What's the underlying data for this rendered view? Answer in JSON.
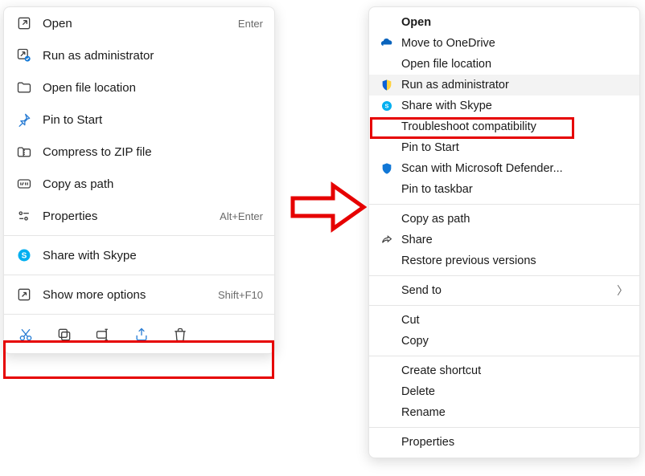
{
  "left_menu": {
    "items": [
      {
        "label": "Open",
        "hotkey": "Enter",
        "icon": "open"
      },
      {
        "label": "Run as administrator",
        "hotkey": "",
        "icon": "admin"
      },
      {
        "label": "Open file location",
        "hotkey": "",
        "icon": "folder"
      },
      {
        "label": "Pin to Start",
        "hotkey": "",
        "icon": "pin"
      },
      {
        "label": "Compress to ZIP file",
        "hotkey": "",
        "icon": "zip"
      },
      {
        "label": "Copy as path",
        "hotkey": "",
        "icon": "path"
      },
      {
        "label": "Properties",
        "hotkey": "Alt+Enter",
        "icon": "props"
      }
    ],
    "skype": {
      "label": "Share with Skype",
      "icon": "skype"
    },
    "more": {
      "label": "Show more options",
      "hotkey": "Shift+F10",
      "icon": "more"
    },
    "toolbar": [
      "cut",
      "copy",
      "rename",
      "share",
      "delete"
    ]
  },
  "right_menu": {
    "g1": [
      {
        "label": "Open",
        "bold": true,
        "icon": ""
      },
      {
        "label": "Move to OneDrive",
        "icon": "onedrive"
      },
      {
        "label": "Open file location",
        "icon": ""
      },
      {
        "label": "Run as administrator",
        "icon": "shield",
        "hover": true
      },
      {
        "label": "Share with Skype",
        "icon": "skype"
      },
      {
        "label": "Troubleshoot compatibility",
        "icon": ""
      },
      {
        "label": "Pin to Start",
        "icon": ""
      },
      {
        "label": "Scan with Microsoft Defender...",
        "icon": "defender"
      },
      {
        "label": "Pin to taskbar",
        "icon": ""
      }
    ],
    "g2": [
      {
        "label": "Copy as path",
        "icon": ""
      },
      {
        "label": "Share",
        "icon": "share"
      },
      {
        "label": "Restore previous versions",
        "icon": ""
      }
    ],
    "g3": [
      {
        "label": "Send to",
        "icon": "",
        "submenu": true
      }
    ],
    "g4": [
      {
        "label": "Cut",
        "icon": ""
      },
      {
        "label": "Copy",
        "icon": ""
      }
    ],
    "g5": [
      {
        "label": "Create shortcut",
        "icon": ""
      },
      {
        "label": "Delete",
        "icon": ""
      },
      {
        "label": "Rename",
        "icon": ""
      }
    ],
    "g6": [
      {
        "label": "Properties",
        "icon": ""
      }
    ]
  },
  "colors": {
    "highlight": "#e60000",
    "skype": "#00aff0",
    "shield_y": "#ffd23e",
    "shield_b": "#0b61d8",
    "defender": "#1177d6",
    "onedrive": "#0a64bd"
  }
}
